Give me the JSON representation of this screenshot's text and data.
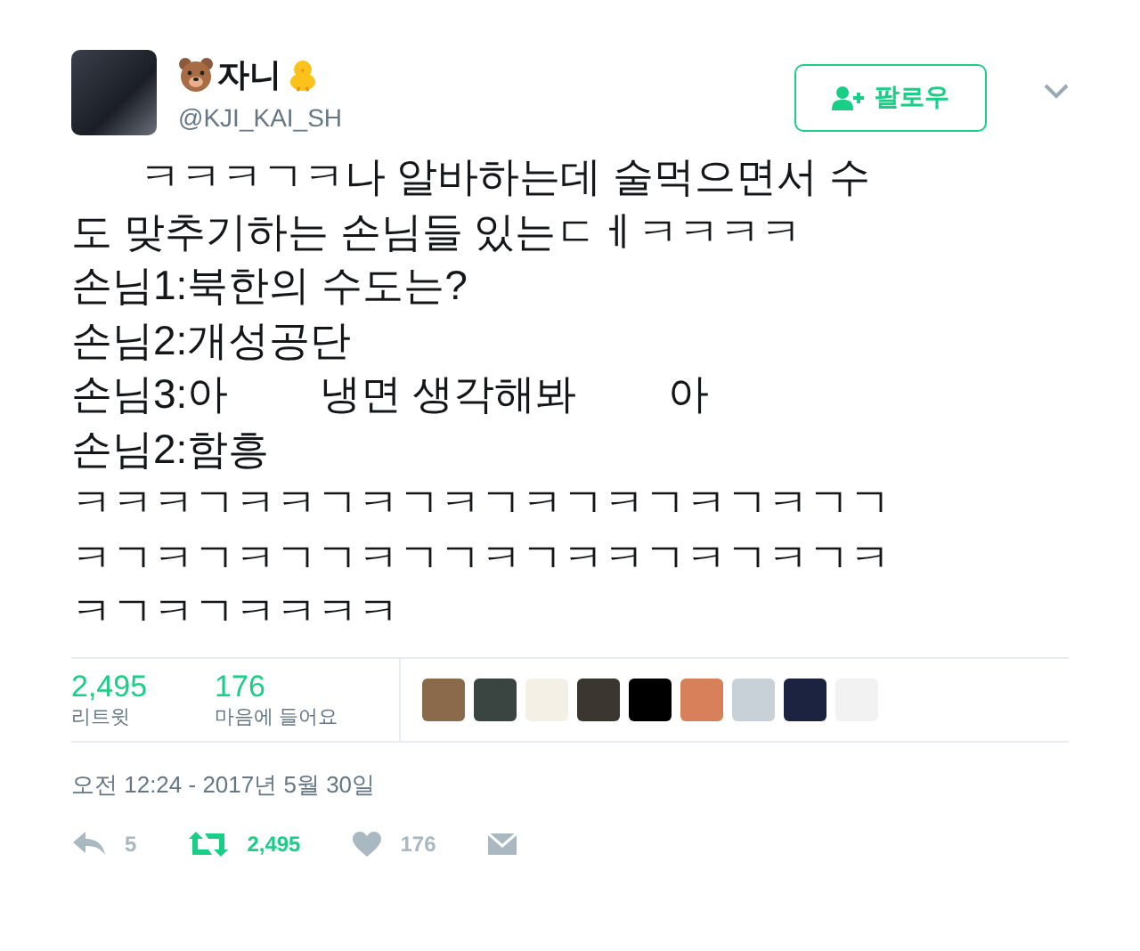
{
  "author": {
    "name": "자니",
    "handle": "@KJI_KAI_SH"
  },
  "follow_button": {
    "label": "팔로우"
  },
  "tweet_lines": [
    "      ㅋㅋㅋㄱㅋ나 알바하는데 술먹으면서 수",
    "도 맞추기하는 손님들 있는ㄷㅔㅋㅋㅋㅋ",
    "손님1:북한의 수도는?",
    "손님2:개성공단",
    "손님3:아        냉면 생각해봐        아",
    "손님2:함흥",
    "ㅋㅋㅋㄱㅋㅋㄱㅋㄱㅋㄱㅋㄱㅋㄱㅋㄱㅋㄱㄱ",
    "ㅋㄱㅋㄱㅋㄱㄱㅋㄱㄱㅋㄱㅋㅋㄱㅋㄱㅋㄱㅋ",
    "ㅋㄱㅋㄱㅋㅋㅋㅋ"
  ],
  "stats": [
    {
      "value": "2,495",
      "label": "리트윗"
    },
    {
      "value": "176",
      "label": "마음에 들어요"
    }
  ],
  "timestamp": "오전 12:24 - 2017년 5월 30일",
  "actions": [
    {
      "kind": "reply",
      "count": "5"
    },
    {
      "kind": "retweet",
      "count": "2,495"
    },
    {
      "kind": "like",
      "count": "176"
    },
    {
      "kind": "message"
    }
  ]
}
